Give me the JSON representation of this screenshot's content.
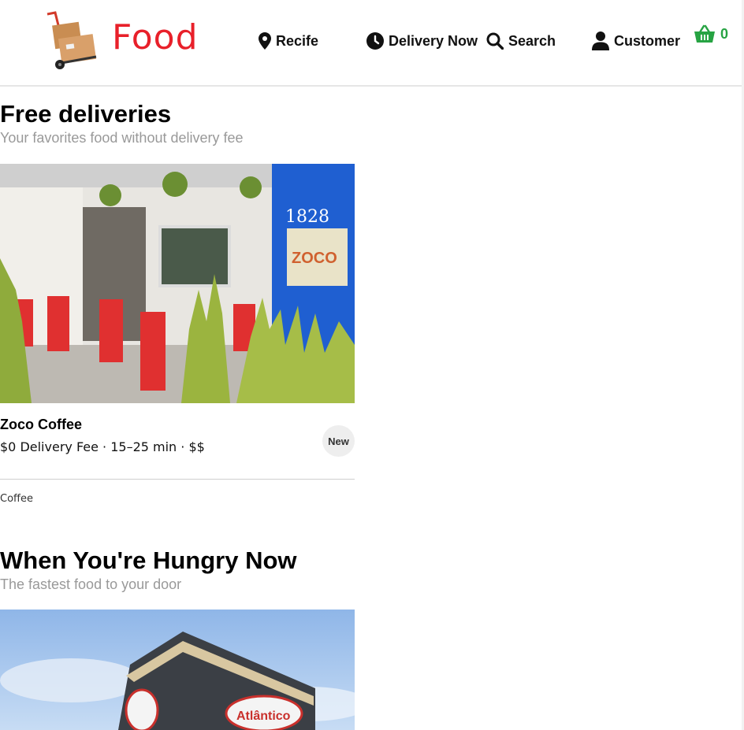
{
  "header": {
    "brand": "Food",
    "nav": {
      "location": "Recife",
      "delivery": "Delivery Now",
      "search": "Search",
      "account": "Customer"
    },
    "cart_count": "0",
    "accent_color": "#27a343",
    "brand_color": "#e8202a"
  },
  "sections": [
    {
      "title": "Free deliveries",
      "subtitle": "Your favorites food without delivery fee",
      "card": {
        "name": "Zoco Coffee",
        "meta": "$0 Delivery Fee · 15–25 min · $$",
        "badge": "New",
        "category": "Coffee",
        "sign_text": "ZOCO",
        "house_number": "1828"
      }
    },
    {
      "title": "When You're Hungry Now",
      "subtitle": "The fastest food to your door",
      "card": {
        "sign_text": "Atlântico"
      }
    }
  ]
}
